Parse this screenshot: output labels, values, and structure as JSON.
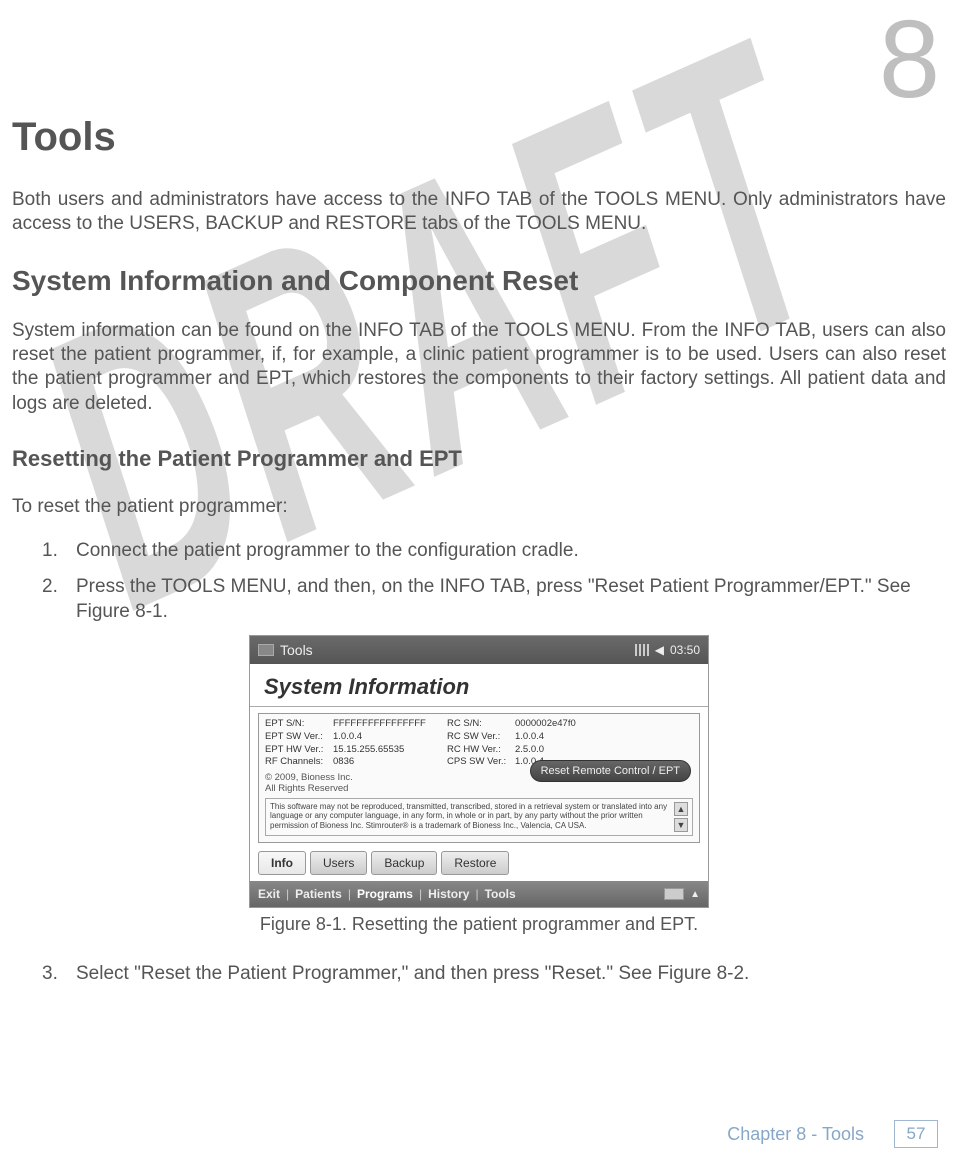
{
  "chapter_number": "8",
  "title": "Tools",
  "intro": "Both users and administrators have access to the INFO TAB of the TOOLS MENU. Only administrators have access to the USERS, BACKUP and RESTORE tabs of the TOOLS MENU.",
  "h2": "System Information and Component Reset",
  "para2": "System information can be found on the INFO TAB of the TOOLS MENU. From the INFO TAB, users can also reset the patient programmer, if, for example, a clinic patient programmer is to be used. Users can also reset the patient programmer and EPT, which restores the components to their factory settings. All patient data and logs are deleted.",
  "h3": "Resetting the Patient Programmer and EPT",
  "lead": "To reset the patient programmer:",
  "steps": {
    "s1_num": "1.",
    "s1": "Connect the patient programmer to the configuration cradle.",
    "s2_num": "2.",
    "s2": "Press the TOOLS MENU, and then, on the INFO TAB, press \"Reset Patient Programmer/EPT.\" See Figure 8-1.",
    "s3_num": "3.",
    "s3": "Select \"Reset the Patient Programmer,\" and then press \"Reset.\" See Figure 8-2."
  },
  "device": {
    "topbar_title": "Tools",
    "time": "03:50",
    "screen_title": "System Information",
    "kv": {
      "k1": "EPT S/N:",
      "v1": "FFFFFFFFFFFFFFFF",
      "k2": "RC S/N:",
      "v2": "0000002e47f0",
      "k3": "EPT SW Ver.:",
      "v3": "1.0.0.4",
      "k4": "RC SW Ver.:",
      "v4": "1.0.0.4",
      "k5": "EPT HW Ver.:",
      "v5": "15.15.255.65535",
      "k6": "RC HW Ver.:",
      "v6": "2.5.0.0",
      "k7": "RF Channels:",
      "v7": "0836",
      "k8": "CPS SW Ver.:",
      "v8": "1.0.0.4"
    },
    "copyright_line1": "© 2009, Bioness Inc.",
    "copyright_line2": "All Rights Reserved",
    "reset_button": "Reset Remote Control / EPT",
    "legal": "This software may not be reproduced, transmitted, transcribed, stored in a retrieval system or translated into any language or any computer language, in any form, in whole or in part, by any party without the prior written permission of Bioness Inc. Stimrouter® is a trademark of Bioness Inc., Valencia, CA USA.",
    "tabs": {
      "info": "Info",
      "users": "Users",
      "backup": "Backup",
      "restore": "Restore"
    },
    "menu": {
      "exit": "Exit",
      "patients": "Patients",
      "programs": "Programs",
      "history": "History",
      "tools": "Tools"
    }
  },
  "caption": "Figure 8-1. Resetting the patient programmer and EPT.",
  "footer": {
    "chapter": "Chapter 8 - Tools",
    "page": "57"
  },
  "watermark": "DRAFT"
}
